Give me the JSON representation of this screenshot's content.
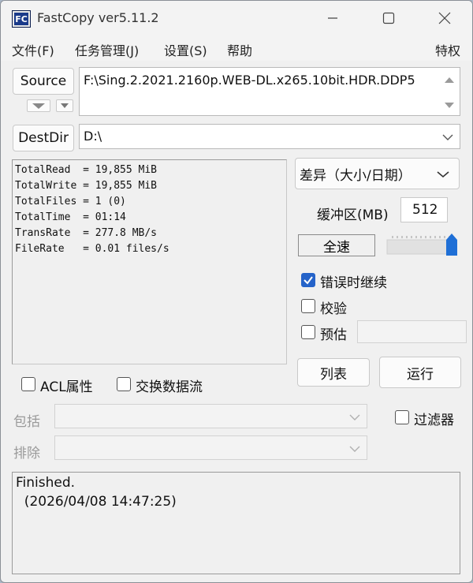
{
  "window": {
    "title": "FastCopy ver5.11.2",
    "app_icon_text": "FC"
  },
  "menu": {
    "items": [
      "文件(F)",
      "任务管理(J)",
      "设置(S)",
      "帮助"
    ],
    "right": "特权"
  },
  "source": {
    "button_label": "Source",
    "path": "F:\\Sing.2.2021.2160p.WEB-DL.x265.10bit.HDR.DDP5"
  },
  "destdir": {
    "button_label": "DestDir",
    "path": "D:\\"
  },
  "stats": {
    "lines": [
      "TotalRead  = 19,855 MiB",
      "TotalWrite = 19,855 MiB",
      "TotalFiles = 1 (0)",
      "TotalTime  = 01:14",
      "TransRate  = 277.8 MB/s",
      "FileRate   = 0.01 files/s"
    ]
  },
  "mode": {
    "selected": "差异（大小/日期）"
  },
  "buffer": {
    "label": "缓冲区(MB)",
    "value": "512"
  },
  "speed": {
    "label": "全速",
    "level": 1.0
  },
  "options": {
    "continue_on_error": {
      "label": "错误时继续",
      "checked": true
    },
    "verify": {
      "label": "校验",
      "checked": false
    },
    "estimate": {
      "label": "预估",
      "checked": false,
      "value": ""
    }
  },
  "buttons": {
    "list": "列表",
    "run": "运行"
  },
  "extras": {
    "acl": {
      "label": "ACL属性",
      "checked": false
    },
    "streams": {
      "label": "交换数据流",
      "checked": false
    },
    "filter": {
      "label": "过滤器",
      "checked": false
    }
  },
  "filters": {
    "include_label": "包括",
    "exclude_label": "排除",
    "include_value": "",
    "exclude_value": ""
  },
  "log": {
    "line1": "Finished.",
    "line2": "  (2026/04/08 14:47:25)"
  }
}
